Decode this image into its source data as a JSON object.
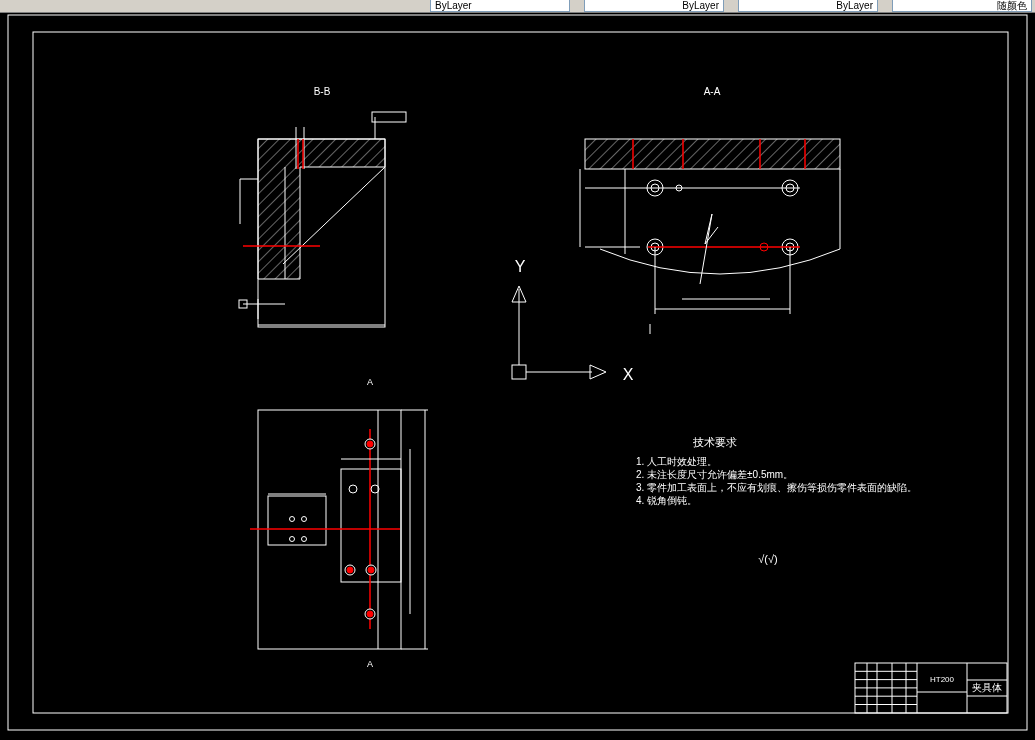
{
  "toolbar": {
    "dropdowns": [
      {
        "value": "ByLayer"
      },
      {
        "value": "ByLayer"
      },
      {
        "value": "ByLayer"
      },
      {
        "value": "随颜色"
      }
    ]
  },
  "views": [
    {
      "kind": "section-bb",
      "label": "B-B"
    },
    {
      "kind": "section-aa",
      "label": "A-A"
    },
    {
      "kind": "view-a",
      "label": "A",
      "caption_label": "A"
    }
  ],
  "ucs": {
    "y_label": "Y",
    "x_label": "X"
  },
  "technical_requirements": {
    "title": "技术要求",
    "items": [
      "1. 人工时效处理。",
      "2. 未注长度尺寸允许偏差±0.5mm。",
      "3. 零件加工表面上，不应有划痕、擦伤等损伤零件表面的缺陷。",
      "4. 锐角倒钝。"
    ]
  },
  "roughness_note": "√(√)",
  "title_block": {
    "material": "HT200",
    "part_name": "夹具体"
  }
}
